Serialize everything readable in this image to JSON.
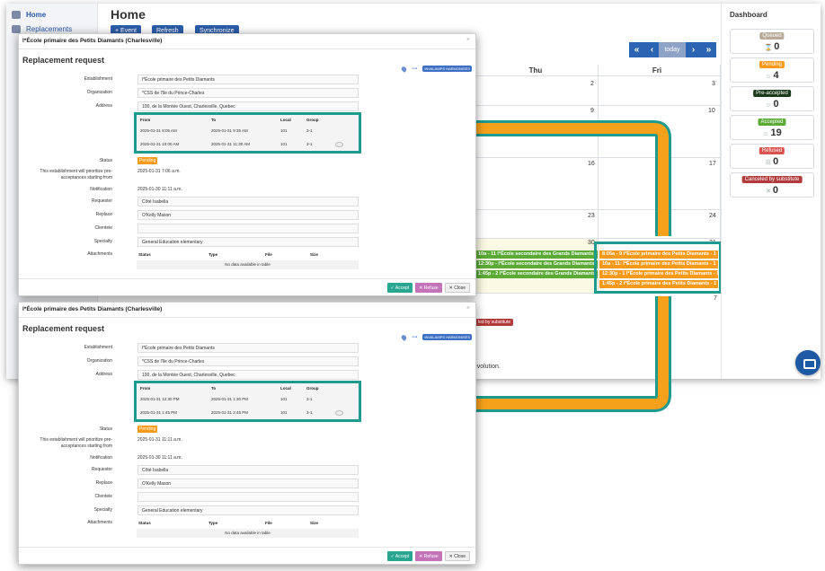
{
  "nav": {
    "home": "Home",
    "replacements": "Replacements"
  },
  "page": {
    "title": "Home",
    "toolbar": [
      "+ Event",
      "Refresh",
      "Synchronize"
    ]
  },
  "calendar": {
    "nav_prev2": "«",
    "nav_prev": "‹",
    "today": "today",
    "nav_next": "›",
    "nav_next2": "»",
    "days": [
      "Thu",
      "Fri"
    ],
    "day_numbers": {
      "thu1": "2",
      "fri1": "3",
      "thu2": "9",
      "fri2": "10",
      "thu3": "16",
      "fri3": "17",
      "thu4": "23",
      "fri4": "24",
      "thu5": "30",
      "fri5": "31",
      "fri6": "7"
    },
    "thu_events": [
      "10a - 11 l*École secondaire des Grands Diamants",
      "12:30p - l*École secondaire des Grands Diamants",
      "1:45p - 2 l*École secondaire des Grands Diamants"
    ],
    "fri_events": [
      "8:05a - 9 l*École primaire des Petits Diamants - 1",
      "10a - 11: l*École primaire des Petits Diamants - 1",
      "12:30p - 1 l*École primaire des Petits Diamants - 1",
      "1:45p - 2 l*École primaire des Petits Diamants - 1"
    ],
    "bg_badge": "led by substitute",
    "bg_text": "e evolution."
  },
  "dashboard": {
    "title": "Dashboard",
    "cards": [
      {
        "label": "Queued",
        "count": "0",
        "color": "#b9aa98"
      },
      {
        "label": "Pending",
        "count": "4",
        "color": "#f79a1a"
      },
      {
        "label": "Pre-accepted",
        "count": "0",
        "color": "#1b3a1b"
      },
      {
        "label": "Accepted",
        "count": "19",
        "color": "#5aaa35"
      },
      {
        "label": "Refused",
        "count": "0",
        "color": "#d9534f"
      },
      {
        "label": "Canceled by substitute",
        "count": "0",
        "color": "#b23a3a"
      }
    ]
  },
  "modal1": {
    "establishment_header": "l*École primaire des Petits Diamants (Charlesville)",
    "title": "Replacement request",
    "tag": "INVALAMPS HARMONISES",
    "establishment_label": "Establishment",
    "establishment": "l*École primaire des Petits Diamants",
    "organization_label": "Organization",
    "organization": "*CSS de l'île du Prince-Charles",
    "address_label": "Address",
    "address": "100, de la Montée Ouest, Charlesville, Quebec",
    "table_headers": [
      "From",
      "To",
      "Local",
      "Group"
    ],
    "rows": [
      {
        "from": "2025-01-31 8:05 AM",
        "to": "2025-01-31 9:35 AM",
        "local": "101",
        "group": "3-1"
      },
      {
        "from": "2025-01-31 10:00 AM",
        "to": "2025-01-31 11:30 AM",
        "local": "101",
        "group": "3-1"
      }
    ],
    "status_label": "Status",
    "status": "Pending",
    "prio_label": "This establishment will prioritize pre-acceptances starting from",
    "prio_value": "2025-01-31 7:06 a.m.",
    "notification_label": "Notification",
    "notification": "2025-01-30 11:11 a.m.",
    "requester_label": "Requester",
    "requester": "Côté Isabella",
    "replace_label": "Replace",
    "replace": "O'Kelly Mason",
    "clientele_label": "Clientele",
    "clientele": "",
    "specialty_label": "Specialty",
    "specialty": "General Education elementary",
    "attachments_label": "Attachments",
    "att_headers": [
      "Status",
      "Type",
      "File",
      "Size"
    ],
    "att_empty": "No data available in table",
    "accept": "✓ Accept",
    "refuse": "✕ Refuse",
    "close": "✕ Close"
  },
  "modal2": {
    "establishment_header": "l*École primaire des Petits Diamants (Charlesville)",
    "title": "Replacement request",
    "tag": "INVALAMPS HARMONISES",
    "establishment_label": "Establishment",
    "establishment": "l*École primaire des Petits Diamants",
    "organization_label": "Organization",
    "organization": "*CSS de l'île du Prince-Charles",
    "address_label": "Address",
    "address": "100, de la Montée Ouest, Charlesville, Quebec",
    "table_headers": [
      "From",
      "To",
      "Local",
      "Group"
    ],
    "rows": [
      {
        "from": "2025-01-31 12:30 PM",
        "to": "2025-01-31 1:30 PM",
        "local": "101",
        "group": "3-1"
      },
      {
        "from": "2025-01-31 1:45 PM",
        "to": "2025-01-31 2:45 PM",
        "local": "101",
        "group": "3-1"
      }
    ],
    "status_label": "Status",
    "status": "Pending",
    "prio_label": "This establishment will prioritize pre-acceptances starting from",
    "prio_value": "2025-01-31 11:11 a.m.",
    "notification_label": "Notification",
    "notification": "2025-01-30 11:11 a.m.",
    "requester_label": "Requester",
    "requester": "Côté Isabella",
    "replace_label": "Replace",
    "replace": "O'Kelly Mason",
    "clientele_label": "Clientele",
    "clientele": "",
    "specialty_label": "Specialty",
    "specialty": "General Education elementary",
    "attachments_label": "Attachments",
    "att_headers": [
      "Status",
      "Type",
      "File",
      "Size"
    ],
    "att_empty": "No data available in table",
    "accept": "✓ Accept",
    "refuse": "✕ Refuse",
    "close": "✕ Close"
  },
  "colors": {
    "accent": "#2c5da8",
    "highlight": "#1f9a8e",
    "arrow": "#f5a11c"
  }
}
